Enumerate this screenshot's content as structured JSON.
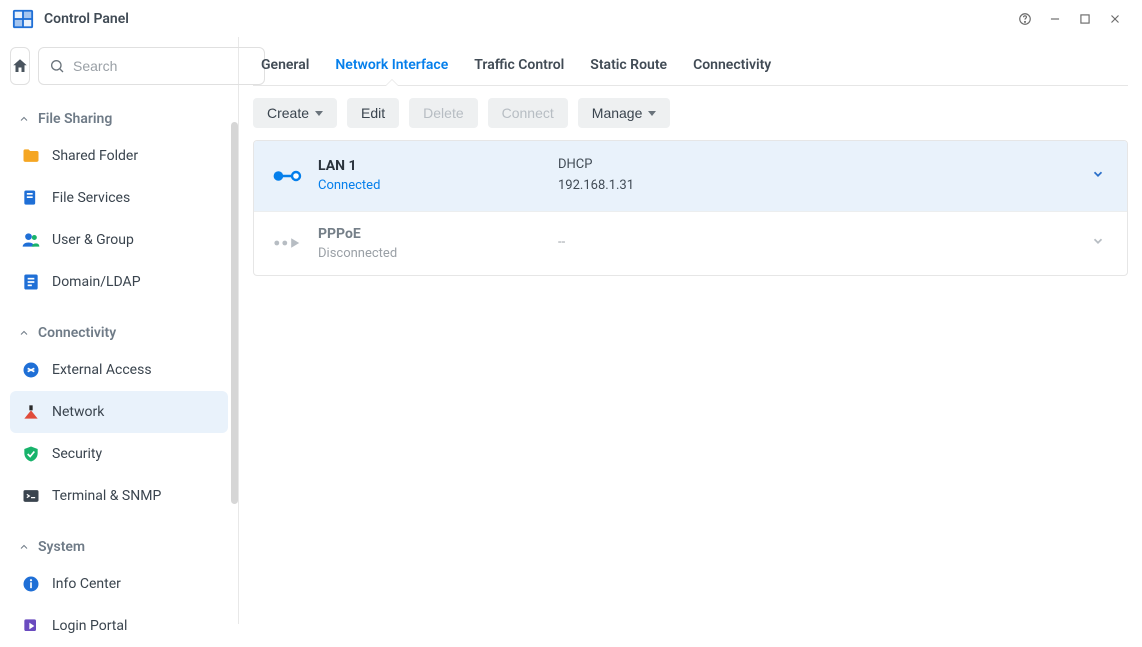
{
  "window": {
    "title": "Control Panel"
  },
  "search": {
    "placeholder": "Search"
  },
  "sidebar": {
    "groups": [
      {
        "label": "File Sharing",
        "items": [
          {
            "label": "Shared Folder"
          },
          {
            "label": "File Services"
          },
          {
            "label": "User & Group"
          },
          {
            "label": "Domain/LDAP"
          }
        ]
      },
      {
        "label": "Connectivity",
        "items": [
          {
            "label": "External Access"
          },
          {
            "label": "Network",
            "active": true
          },
          {
            "label": "Security"
          },
          {
            "label": "Terminal & SNMP"
          }
        ]
      },
      {
        "label": "System",
        "items": [
          {
            "label": "Info Center"
          },
          {
            "label": "Login Portal"
          }
        ]
      }
    ]
  },
  "tabs": [
    {
      "label": "General"
    },
    {
      "label": "Network Interface",
      "active": true
    },
    {
      "label": "Traffic Control"
    },
    {
      "label": "Static Route"
    },
    {
      "label": "Connectivity"
    }
  ],
  "toolbar": {
    "create": "Create",
    "edit": "Edit",
    "delete": "Delete",
    "connect": "Connect",
    "manage": "Manage"
  },
  "interfaces": [
    {
      "name": "LAN 1",
      "status": "Connected",
      "mode": "DHCP",
      "ip": "192.168.1.31",
      "selected": true,
      "connected": true
    },
    {
      "name": "PPPoE",
      "status": "Disconnected",
      "mode": "--",
      "ip": "",
      "selected": false,
      "connected": false
    }
  ]
}
